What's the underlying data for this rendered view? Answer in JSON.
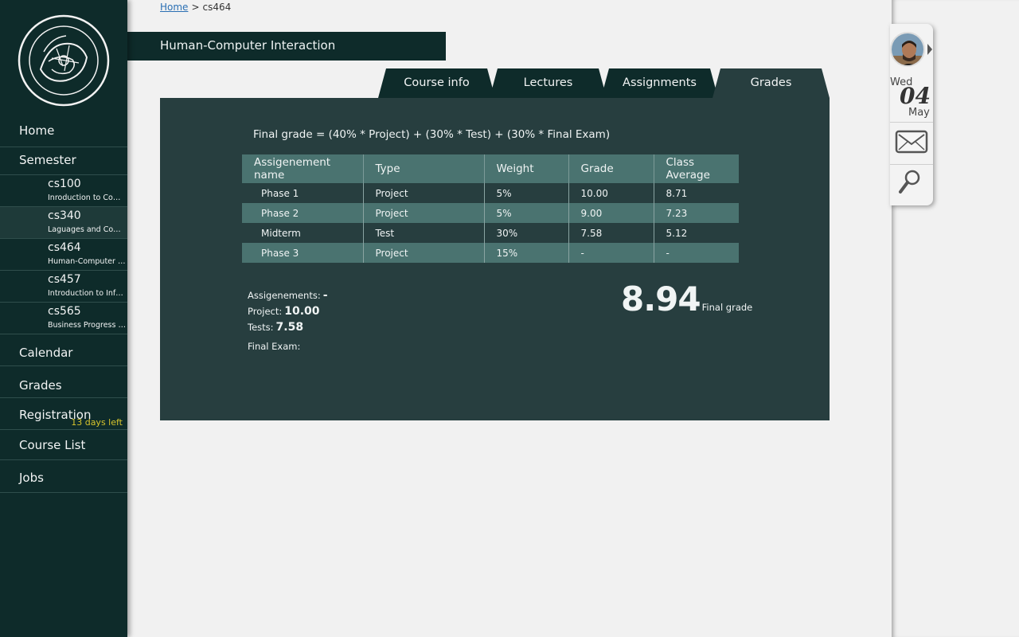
{
  "breadcrumb": {
    "home": "Home",
    "separator": ">",
    "current": "cs464"
  },
  "course_title": "Human-Computer Interaction",
  "sidebar": {
    "home": "Home",
    "semester": "Semester",
    "courses": [
      {
        "code": "cs100",
        "name": "Inroduction to Computer Science"
      },
      {
        "code": "cs340",
        "name": "Laguages and Compilers"
      },
      {
        "code": "cs464",
        "name": "Human-Computer Interaction"
      },
      {
        "code": "cs457",
        "name": "Introduction to Information Systems"
      },
      {
        "code": "cs565",
        "name": "Business Progress Management"
      }
    ],
    "calendar": "Calendar",
    "grades": "Grades",
    "registration": "Registration",
    "registration_badge": "13 days left",
    "course_list": "Course List",
    "jobs": "Jobs"
  },
  "tabs": [
    "Course info",
    "Lectures",
    "Assignments",
    "Grades"
  ],
  "active_tab": "Grades",
  "formula": "Final grade = (40% * Project) + (30% * Test) + (30% * Final Exam)",
  "table": {
    "headers": [
      "Assigenement name",
      "Type",
      "Weight",
      "Grade",
      "Class Average"
    ],
    "rows": [
      [
        "Phase 1",
        "Project",
        "5%",
        "10.00",
        "8.71"
      ],
      [
        "Phase 2",
        "Project",
        "5%",
        "9.00",
        "7.23"
      ],
      [
        "Midterm",
        "Test",
        "30%",
        "7.58",
        "5.12"
      ],
      [
        "Phase 3",
        "Project",
        "15%",
        "-",
        "-"
      ]
    ]
  },
  "summary": {
    "assignments_label": "Assigenements:",
    "assignments_value": "-",
    "project_label": "Project:",
    "project_value": "10.00",
    "tests_label": "Tests:",
    "tests_value": "7.58",
    "final_exam_label": "Final Exam:",
    "final_exam_value": ""
  },
  "final_grade": {
    "value": "8.94",
    "label": "Final grade"
  },
  "widget": {
    "day": "Wed",
    "date": "04",
    "month": "May"
  },
  "colors": {
    "sidebar_bg": "#0e2b2a",
    "panel_bg": "#273e3f",
    "row_alt": "#4a7370",
    "badge": "#d7c42d",
    "link": "#2a6fb3"
  }
}
